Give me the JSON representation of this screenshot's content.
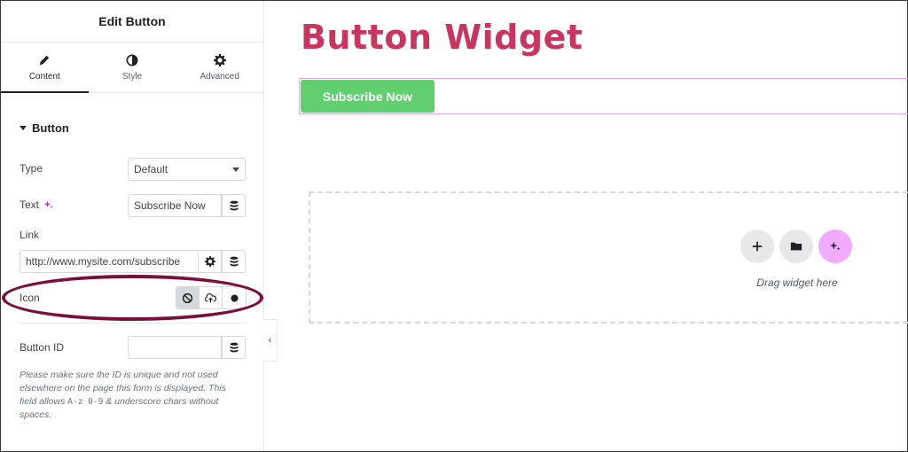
{
  "panel": {
    "title": "Edit Button",
    "tabs": [
      {
        "label": "Content",
        "icon": "pencil-icon",
        "active": true
      },
      {
        "label": "Style",
        "icon": "half-circle-icon",
        "active": false
      },
      {
        "label": "Advanced",
        "icon": "gear-icon",
        "active": false
      }
    ],
    "section_title": "Button",
    "fields": {
      "type": {
        "label": "Type",
        "value": "Default"
      },
      "text": {
        "label": "Text",
        "value": "Subscribe Now"
      },
      "link": {
        "label": "Link",
        "value": "http://www.mysite.com/subscribe"
      },
      "icon": {
        "label": "Icon",
        "options": [
          "none",
          "upload",
          "library"
        ],
        "selected": "none"
      },
      "button_id": {
        "label": "Button ID",
        "value": ""
      }
    },
    "help": {
      "part1": "Please make sure the ID is unique and not used elsewhere on the page this form is displayed. This field allows ",
      "code": "A-z 0-9",
      "part2": " & underscore chars without spaces."
    },
    "collapse_glyph": "‹"
  },
  "canvas": {
    "title": "Button Widget",
    "button_label": "Subscribe Now",
    "dropzone_text": "Drag widget here",
    "dropzone_buttons": [
      "plus-icon",
      "folder-icon",
      "ai-sparkle-icon"
    ]
  },
  "colors": {
    "title": "#c9355f",
    "button": "#61ce70",
    "highlight_ellipse": "#7a0f3c",
    "ai_button": "#f0abfc",
    "ai_sparkle": "#c026d3"
  }
}
